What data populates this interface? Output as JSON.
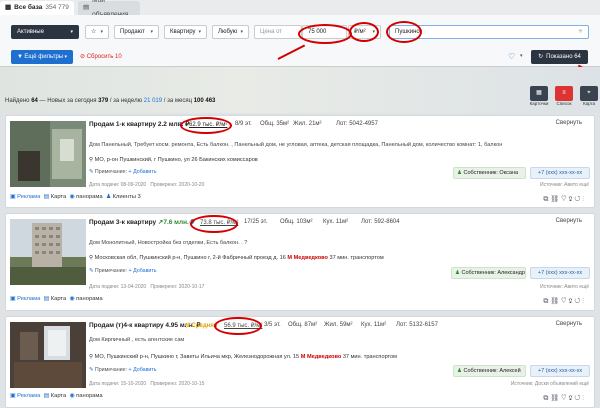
{
  "tabs": {
    "all_label": "Все база",
    "all_count": "354 779",
    "mine_label": "Мои объявления"
  },
  "filters": {
    "status": "Активные",
    "deal": "Продают",
    "type": "Квартиру",
    "rooms": "Любую",
    "price_placeholder": "Цена от",
    "price_value": "75 000",
    "unit": "₽/м²",
    "location": "Пушкино",
    "more": "Ещё фильтры",
    "reset": "Сбросить",
    "reset_count": "10",
    "show": "Показано 64"
  },
  "found": {
    "prefix": "Найдено",
    "total": "64",
    "new_today_label": "— Новых за сегодня",
    "new_today": "379",
    "week_label": "/ за неделю",
    "week": "21 019",
    "month_label": "/ за месяц",
    "month": "100 463"
  },
  "views": {
    "cards": "Карточки",
    "list": "Список",
    "map": "Карта"
  },
  "cards": [
    {
      "title": "Продам 1-к квартиру 2.2 млн. ₽",
      "price_m2": "62.9 тыс. ₽/м²",
      "floor": "8/9 эт.",
      "total": "Общ. 35м²",
      "living": "Жил. 21м²",
      "lot": "Лот: 5042-4957",
      "desc": "Дом Панельный, Требует косм. ремонта, Есть балкон. , Панельный дом, не угловая, аптека, детская площадка, Панельный дом, количество комнат: 1, балкон",
      "addr": "МО, р-он Пушкинский, г Пушкино, ул 26 Бакинских комиссаров",
      "note": "Примечание:",
      "add": "+ Добавить",
      "owner": "Собственник: Оксана",
      "phone": "+7 (xxx) xxx-xx-xx",
      "added": "Дата подачи: 08-09-2020",
      "checked": "Проверено: 2020-10-20",
      "source": "Источник: Авито ещё",
      "collapse": "Свернуть",
      "foot": [
        "Реклама",
        "Карта",
        "панорама",
        "Клиенты 3"
      ]
    },
    {
      "title": "Продам 3-к квартиру",
      "price": "7.6 млн. ₽",
      "price_m2": "73.8 тыс. ₽/м²",
      "floor": "17/25 эт.",
      "total": "Общ. 103м²",
      "kitchen": "Кух. 11м²",
      "lot": "Лот: 592-8604",
      "desc": "Дом Монолитный, Новостройка без отделки, Есть балкон. . ?",
      "addr": "Московская обл, Пушкинский р-н, Пушкино г, 2-й Фабричный проезд д. 16",
      "metro": "М Медведково",
      "metro_time": "37 мин. транспортом",
      "note": "Примечание:",
      "add": "+ Добавить",
      "owner": "Собственник: Александр",
      "phone": "+7 (xxx) xxx-xx-xx",
      "added": "Дата подачи: 13-04-2020",
      "checked": "Проверено: 2020-10-17",
      "source": "Источник: Авито ещё",
      "collapse": "Свернуть",
      "foot": [
        "Реклама",
        "Карта",
        "панорама"
      ]
    },
    {
      "title": "Продам (т)4-к квартиру 4.95 млн. ₽",
      "badge": "Средняя",
      "price_m2": "56.9 тыс. ₽/м²",
      "floor": "3/5 эт.",
      "total": "Общ. 87м²",
      "living": "Жил. 59м²",
      "kitchen": "Кух. 11м²",
      "lot": "Лот: 5132-6157",
      "desc": "Дом Кирпичный , есть агентские сам",
      "addr": "МО, Пушкинский р-н, Пушкино г, Заветы Ильича мкр, Железнодорожная ул. 15",
      "metro": "М Медведково",
      "metro_time": "37 мин. транспортом",
      "note": "Примечание:",
      "add": "+ Добавить",
      "owner": "Собственник: Алексей",
      "phone": "+7 (xxx) xxx-xx-xx",
      "added": "Дата подачи: 15-10-2020",
      "checked": "Проверено: 2020-10-15",
      "source": "Источник: Доски объявлений ещё",
      "collapse": "Свернуть",
      "foot": [
        "Реклама",
        "Карта",
        "панорама"
      ]
    }
  ],
  "colors": {
    "accent": "#1e6fd0",
    "annotation": "#d40000",
    "dark": "#2b3440"
  }
}
